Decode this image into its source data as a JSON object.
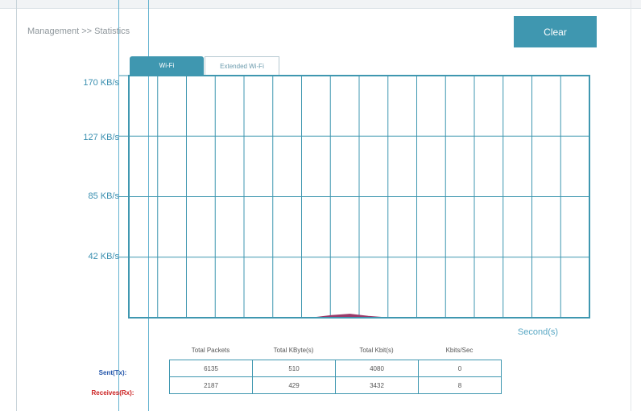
{
  "breadcrumb": "Management >> Statistics",
  "clear_button": "Clear",
  "tabs": [
    {
      "label": "Wi-Fi",
      "active": true
    },
    {
      "label": "Extended Wi-Fi",
      "active": false
    }
  ],
  "chart_data": {
    "type": "area",
    "title": "",
    "xlabel": "Second(s)",
    "ylabel": "",
    "y_ticks": [
      "170 KB/s",
      "127 KB/s",
      "85 KB/s",
      "42 KB/s"
    ],
    "ylim": [
      0,
      170
    ],
    "grid": true,
    "series": [
      {
        "name": "",
        "color": "#9a3a6a",
        "values": [
          0,
          0,
          0,
          0,
          0,
          0,
          0,
          0,
          0,
          0,
          0,
          1.5,
          2.5,
          1,
          0,
          0,
          0,
          0,
          0,
          0,
          0,
          0,
          0,
          0,
          0,
          0
        ]
      }
    ]
  },
  "stats": {
    "columns": [
      "Total Packets",
      "Total KByte(s)",
      "Total Kbit(s)",
      "Kbits/Sec"
    ],
    "rows": [
      {
        "label": "Sent(Tx):",
        "values": [
          "6135",
          "510",
          "4080",
          "0"
        ],
        "color": "#2255aa"
      },
      {
        "label": "Receives(Rx):",
        "values": [
          "2187",
          "429",
          "3432",
          "8"
        ],
        "color": "#cc2222"
      }
    ]
  },
  "colors": {
    "accent": "#3f97b0",
    "grid": "#3f97b0"
  }
}
